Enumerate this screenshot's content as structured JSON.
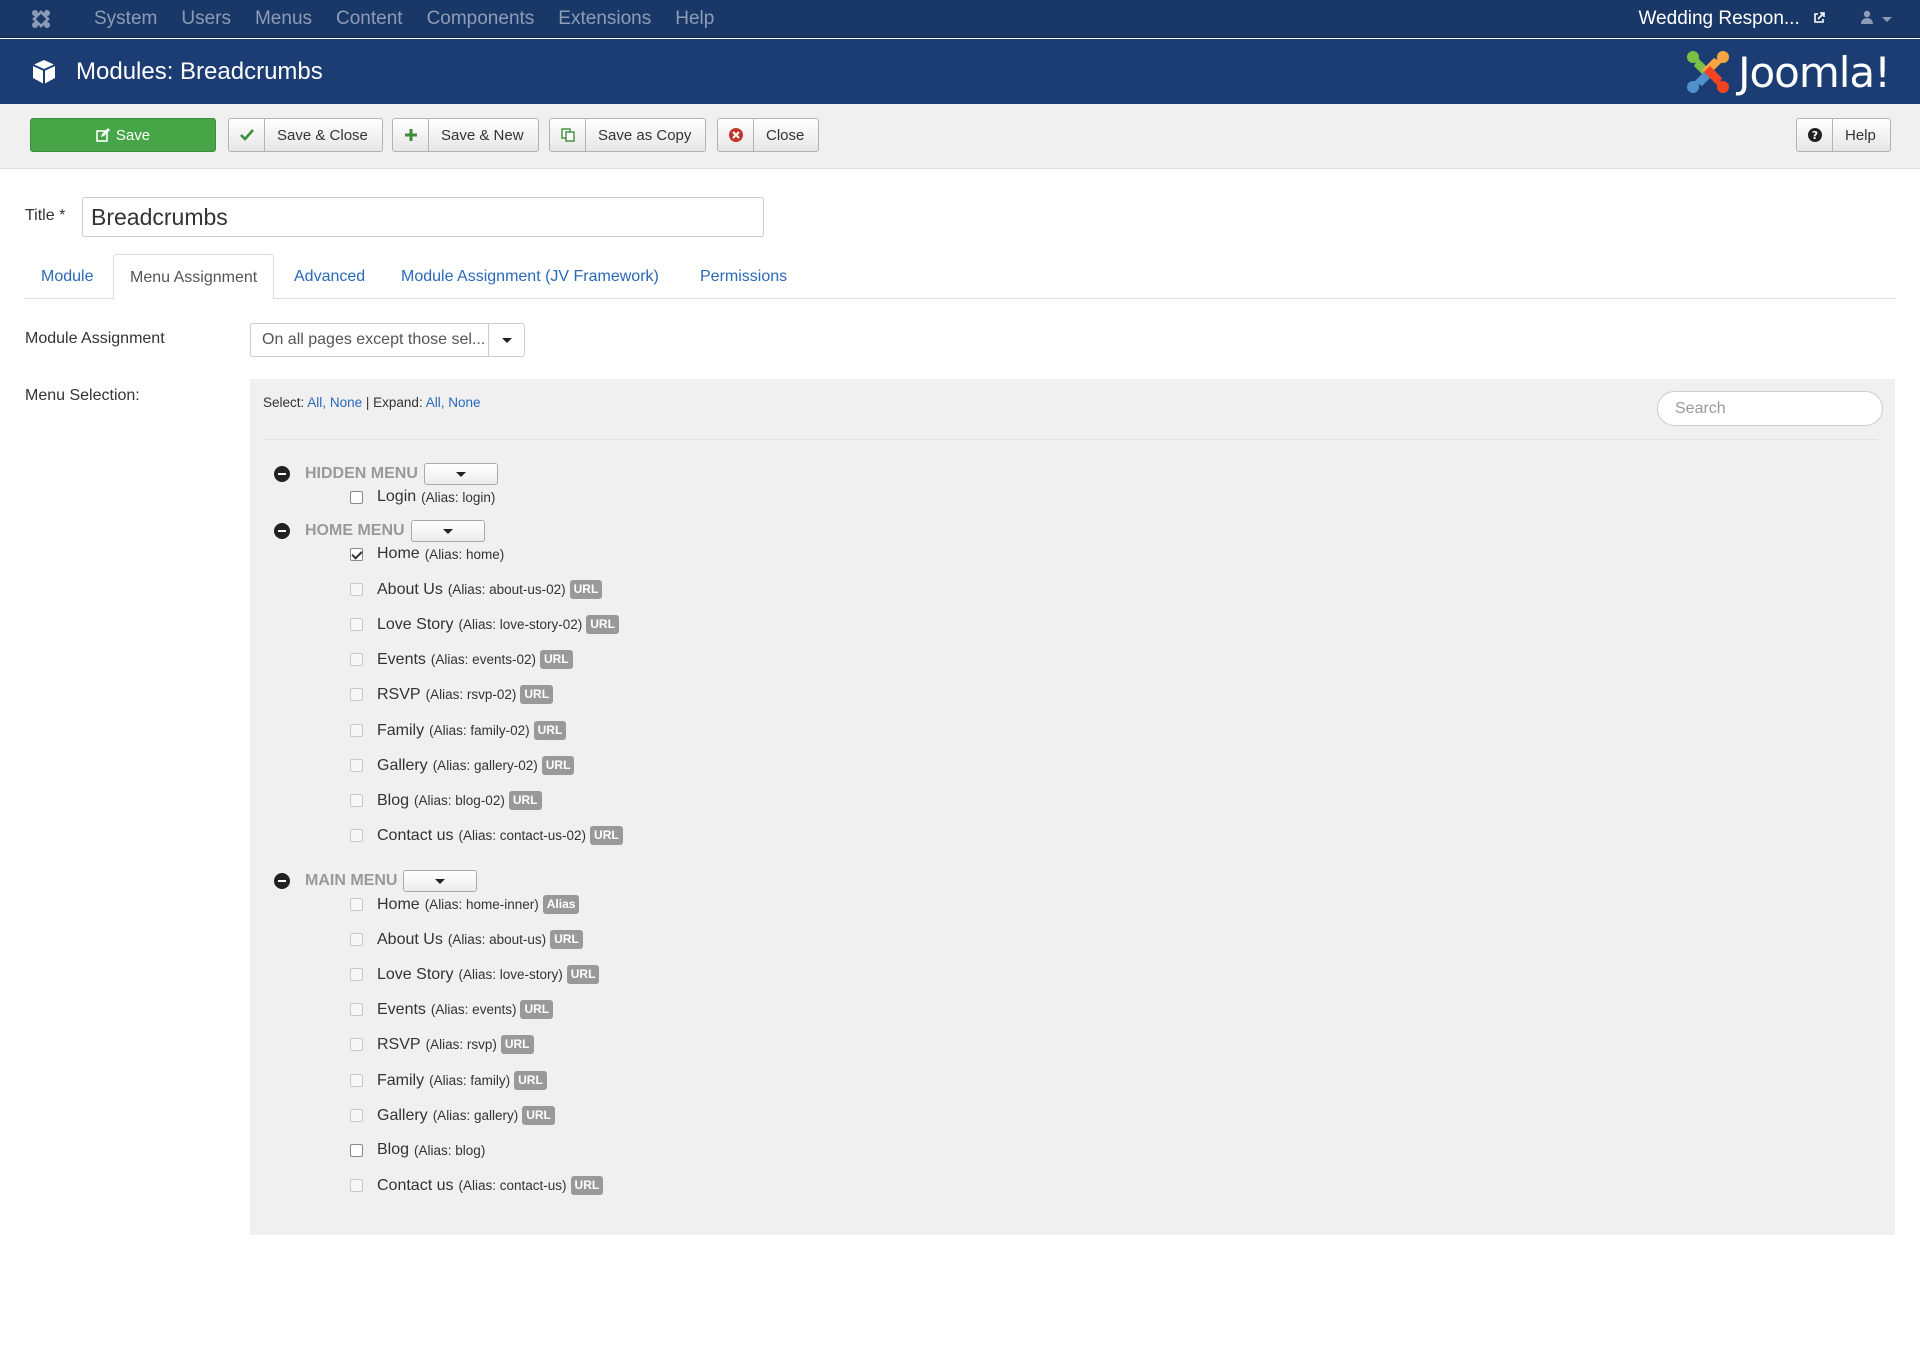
{
  "topnav": {
    "menu": [
      "System",
      "Users",
      "Menus",
      "Content",
      "Components",
      "Extensions",
      "Help"
    ],
    "site_name": "Wedding Respon..."
  },
  "header": {
    "title": "Modules: Breadcrumbs",
    "brand": "Joomla!"
  },
  "toolbar": {
    "save": "Save",
    "save_close": "Save & Close",
    "save_new": "Save & New",
    "save_copy": "Save as Copy",
    "close": "Close",
    "help": "Help"
  },
  "form": {
    "title_label": "Title *",
    "title_value": "Breadcrumbs"
  },
  "tabs": [
    "Module",
    "Menu Assignment",
    "Advanced",
    "Module Assignment (JV Framework)",
    "Permissions"
  ],
  "assignment": {
    "label": "Module Assignment",
    "value": "On all pages except those sel..."
  },
  "menu_selection": {
    "label": "Menu Selection:",
    "select_label": "Select:",
    "all": "All,",
    "none": "None",
    "separator": "|",
    "expand_label": "Expand:",
    "expand_all": "All,",
    "expand_none": "None",
    "search_placeholder": "Search",
    "groups": [
      {
        "name": "HIDDEN MENU",
        "items": [
          {
            "name": "Login",
            "alias": "(Alias: login)",
            "badge": "",
            "checked": false
          }
        ]
      },
      {
        "name": "HOME MENU",
        "items": [
          {
            "name": "Home",
            "alias": "(Alias: home)",
            "badge": "",
            "checked": true
          },
          {
            "name": "About Us",
            "alias": "(Alias: about-us-02)",
            "badge": "URL",
            "checked": false
          },
          {
            "name": "Love Story",
            "alias": "(Alias: love-story-02)",
            "badge": "URL",
            "checked": false
          },
          {
            "name": "Events",
            "alias": "(Alias: events-02)",
            "badge": "URL",
            "checked": false
          },
          {
            "name": "RSVP",
            "alias": "(Alias: rsvp-02)",
            "badge": "URL",
            "checked": false
          },
          {
            "name": "Family",
            "alias": "(Alias: family-02)",
            "badge": "URL",
            "checked": false
          },
          {
            "name": "Gallery",
            "alias": "(Alias: gallery-02)",
            "badge": "URL",
            "checked": false
          },
          {
            "name": "Blog",
            "alias": "(Alias: blog-02)",
            "badge": "URL",
            "checked": false
          },
          {
            "name": "Contact us",
            "alias": "(Alias: contact-us-02)",
            "badge": "URL",
            "checked": false
          }
        ]
      },
      {
        "name": "MAIN MENU",
        "items": [
          {
            "name": "Home",
            "alias": "(Alias: home-inner)",
            "badge": "Alias",
            "checked": false
          },
          {
            "name": "About Us",
            "alias": "(Alias: about-us)",
            "badge": "URL",
            "checked": false
          },
          {
            "name": "Love Story",
            "alias": "(Alias: love-story)",
            "badge": "URL",
            "checked": false
          },
          {
            "name": "Events",
            "alias": "(Alias: events)",
            "badge": "URL",
            "checked": false
          },
          {
            "name": "RSVP",
            "alias": "(Alias: rsvp)",
            "badge": "URL",
            "checked": false
          },
          {
            "name": "Family",
            "alias": "(Alias: family)",
            "badge": "URL",
            "checked": false
          },
          {
            "name": "Gallery",
            "alias": "(Alias: gallery)",
            "badge": "URL",
            "checked": false
          },
          {
            "name": "Blog",
            "alias": "(Alias: blog)",
            "badge": "",
            "checked": false
          },
          {
            "name": "Contact us",
            "alias": "(Alias: contact-us)",
            "badge": "URL",
            "checked": false
          }
        ]
      }
    ]
  },
  "colors": {
    "topnav_bg": "#1a3867",
    "header_bg": "#1c3d74",
    "save_green": "#46a546",
    "link_blue": "#2a69b8",
    "badge_gray": "#999999"
  }
}
